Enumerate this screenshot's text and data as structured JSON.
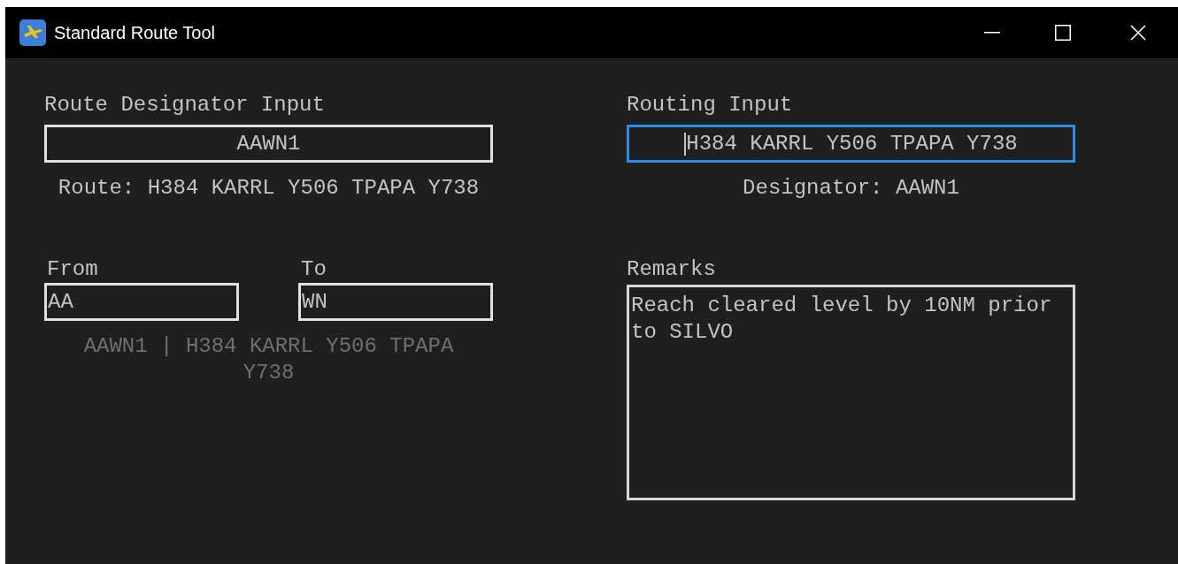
{
  "window": {
    "title": "Standard Route Tool"
  },
  "designator_input": {
    "label": "Route Designator Input",
    "value": "AAWN1",
    "focused": false
  },
  "route_result": "Route: H384 KARRL Y506 TPAPA Y738",
  "routing_input": {
    "label": "Routing Input",
    "value": "H384 KARRL Y506 TPAPA Y738",
    "focused": true
  },
  "designator_result": "Designator: AAWN1",
  "from_input": {
    "label": "From",
    "value": "AA",
    "focused": false
  },
  "to_input": {
    "label": "To",
    "value": "WN",
    "focused": false
  },
  "match_result": "AAWN1 | H384 KARRL Y506 TPAPA Y738",
  "remarks": {
    "label": "Remarks",
    "value": "Reach cleared level by 10NM prior to SILVO"
  }
}
